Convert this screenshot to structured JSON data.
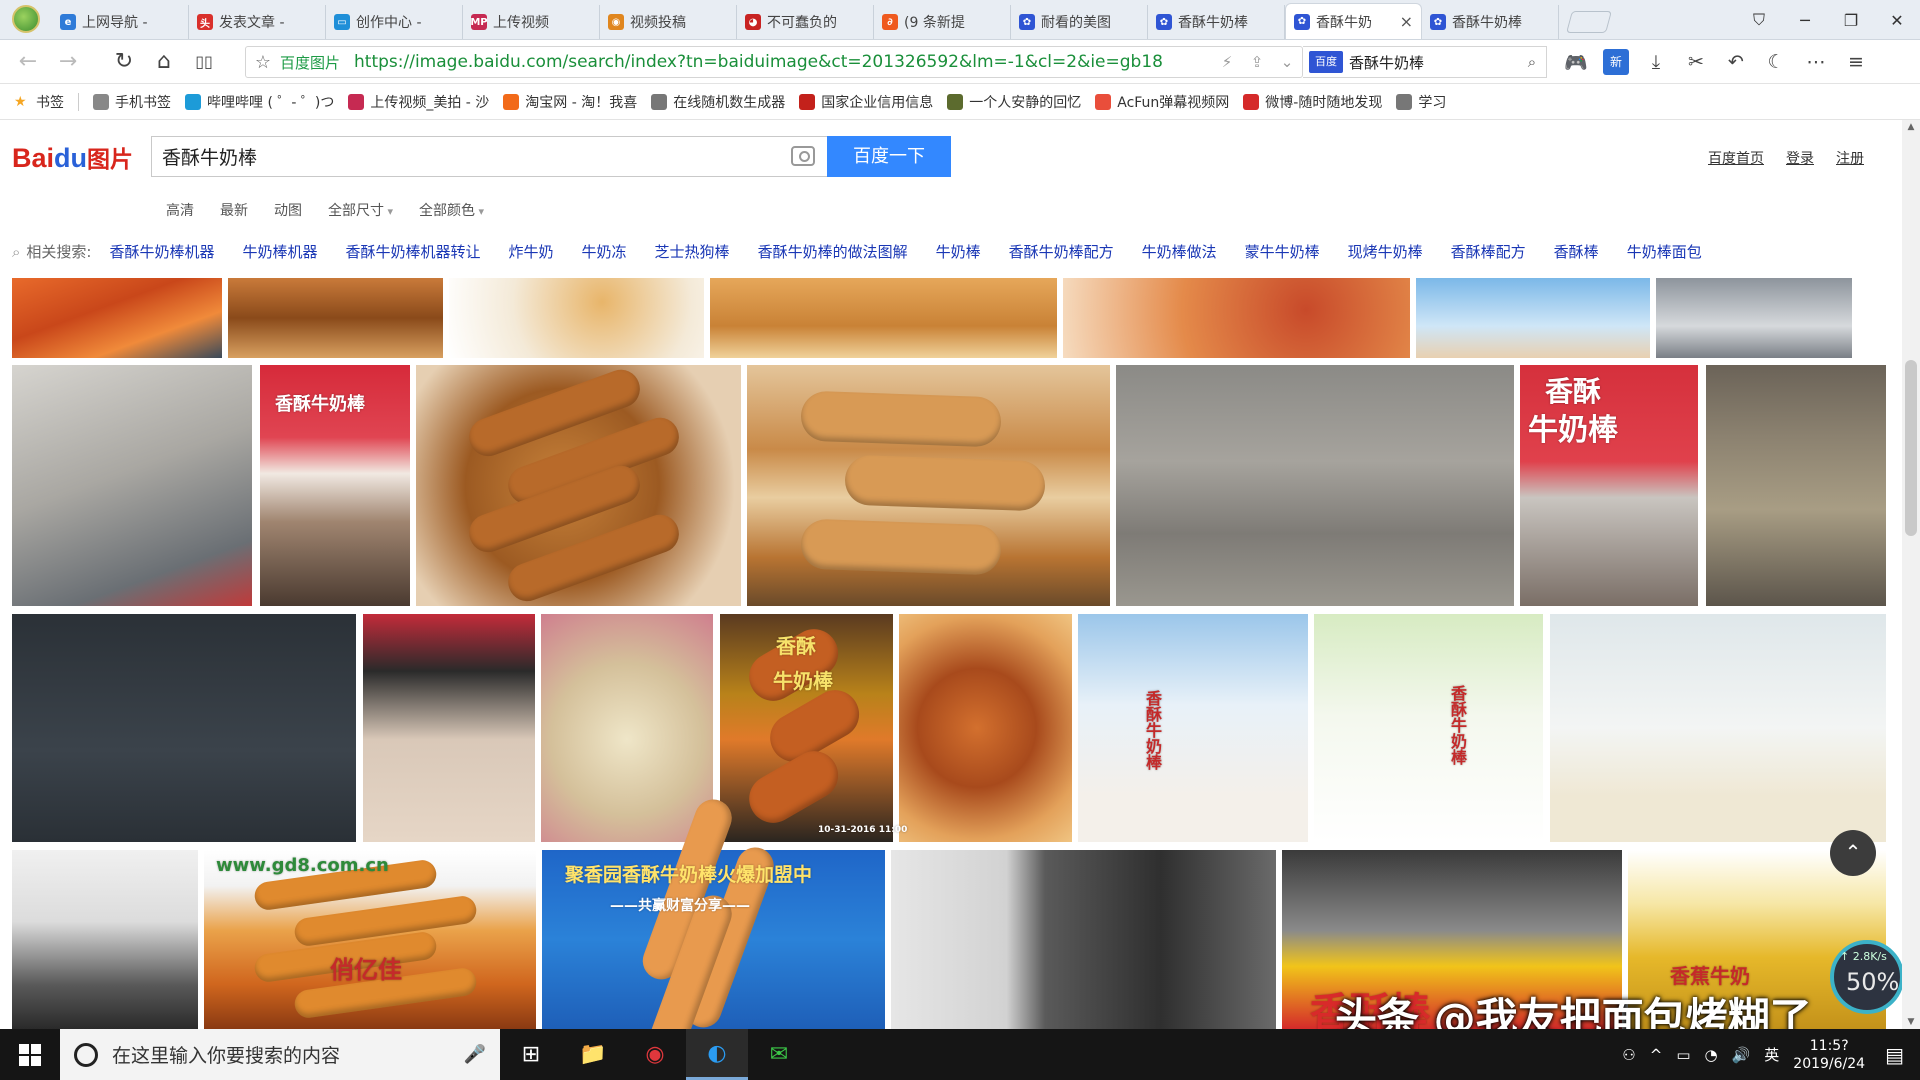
{
  "browser": {
    "tabs": [
      {
        "title": "上网导航 - ",
        "icon_color": "#2f7bd8",
        "icon": "e"
      },
      {
        "title": "发表文章 - ",
        "icon_color": "#d9302b",
        "icon": "头"
      },
      {
        "title": "创作中心 - ",
        "icon_color": "#1f8fd8",
        "icon": "▭"
      },
      {
        "title": "上传视频",
        "icon_color": "#c62a52",
        "icon": "MP"
      },
      {
        "title": "视频投稿",
        "icon_color": "#e0861e",
        "icon": "◉"
      },
      {
        "title": "不可蠢负的",
        "icon_color": "#c82322",
        "icon": "◕"
      },
      {
        "title": "(9 条新提",
        "icon_color": "#ef5a1f",
        "icon": "∂"
      },
      {
        "title": "耐看的美图",
        "icon_color": "#2f55d4",
        "icon": "✿"
      },
      {
        "title": "香酥牛奶棒",
        "icon_color": "#2f55d4",
        "icon": "✿"
      },
      {
        "title": "香酥牛奶",
        "icon_color": "#2f55d4",
        "icon": "✿",
        "active": true
      },
      {
        "title": "香酥牛奶棒",
        "icon_color": "#2f55d4",
        "icon": "✿"
      }
    ],
    "close_glyph": "×",
    "window_controls": [
      "⛉",
      "─",
      "❐",
      "✕"
    ],
    "nav": {
      "back": "←",
      "forward": "→",
      "reload": "↻",
      "home": "⌂",
      "reader": "▯▯"
    },
    "address": {
      "star": "☆",
      "site_label": "百度图片",
      "url": "https://image.baidu.com/search/index?tn=baiduimage&ct=201326592&lm=-1&cl=2&ie=gb18",
      "flash": "⚡",
      "share": "⇪",
      "dropdown": "⌄"
    },
    "search": {
      "engine": "百度",
      "value": "香酥牛奶棒",
      "go": "⌕"
    },
    "tools": [
      "🎮",
      "新",
      "⤓",
      "✂",
      "↶",
      "☾",
      "⋯",
      "≡"
    ]
  },
  "bookmarks": [
    {
      "label": "书签",
      "color": "#f5a623"
    },
    {
      "label": "手机书签",
      "color": "#888888"
    },
    {
      "label": "哔哩哔哩 ( ゜- ゜)つ",
      "color": "#1d9bd8"
    },
    {
      "label": "上传视频_美拍 - 沙",
      "color": "#c62a52"
    },
    {
      "label": "淘宝网 - 淘！我喜",
      "color": "#f26a19"
    },
    {
      "label": "在线随机数生成器",
      "color": "#777777"
    },
    {
      "label": "国家企业信用信息",
      "color": "#c3211b"
    },
    {
      "label": "一个人安静的回忆",
      "color": "#5c6b2e"
    },
    {
      "label": "AcFun弹幕视频网",
      "color": "#e94e3b"
    },
    {
      "label": "微博-随时随地发现",
      "color": "#d52a2a"
    },
    {
      "label": "学习",
      "color": "#777777"
    }
  ],
  "baidu": {
    "logo_bai": "Bai",
    "logo_du": "du",
    "logo_tu": "图片",
    "query": "香酥牛奶棒",
    "button": "百度一下",
    "links": [
      "百度首页",
      "登录",
      "注册"
    ],
    "filters": [
      {
        "label": "高清",
        "dropdown": false
      },
      {
        "label": "最新",
        "dropdown": false
      },
      {
        "label": "动图",
        "dropdown": false
      },
      {
        "label": "全部尺寸",
        "dropdown": true
      },
      {
        "label": "全部颜色",
        "dropdown": true
      }
    ],
    "related_label": "相关搜索:",
    "related": [
      "香酥牛奶棒机器",
      "牛奶棒机器",
      "香酥牛奶棒机器转让",
      "炸牛奶",
      "牛奶冻",
      "芝士热狗棒",
      "香酥牛奶棒的做法图解",
      "牛奶棒",
      "香酥牛奶棒配方",
      "牛奶棒做法",
      "蒙牛牛奶棒",
      "现烤牛奶棒",
      "香酥棒配方",
      "香酥棒",
      "牛奶棒面包"
    ]
  },
  "image_captions": {
    "shop_sign_1": "香酥牛奶棒",
    "shop_sign_2": "香酥",
    "shop_sign_3": "牛奶棒",
    "store_sign": "香酥",
    "store_sign_2": "牛奶棒",
    "bag_text": "香酥牛奶棒",
    "bag_text_2": "香酥牛奶棒",
    "site_mark": "www.gd8.com.cn",
    "brand_mark": "俏亿佳",
    "franchise": "聚香园香酥牛奶棒火爆加盟中",
    "franchise_sub": "——共赢财富分享——",
    "stall_sign": "香酥棒",
    "drink_label": "香蕉牛奶",
    "dates": "10-31-2016 11:00"
  },
  "overlay": {
    "to_top": "⌃",
    "speed_pct": "50%",
    "speed_rate": "↑ 2.8K/s",
    "watermark": "头条 @我友把面包烤糊了"
  },
  "taskbar": {
    "search_placeholder": "在这里输入你要搜索的内容",
    "mic": "🎤",
    "apps": [
      "⊞",
      "📁",
      "◉",
      "◐",
      "✉"
    ],
    "tray": [
      "⚇",
      "^",
      "▭",
      "◔",
      "🔊",
      "英"
    ],
    "time": "11:5?",
    "date": "2019/6/24",
    "notify": "▤"
  },
  "colors": {
    "baidu_blue": "#3388ff",
    "related_link": "#1a37b5",
    "url_green": "#1a8f3a"
  }
}
